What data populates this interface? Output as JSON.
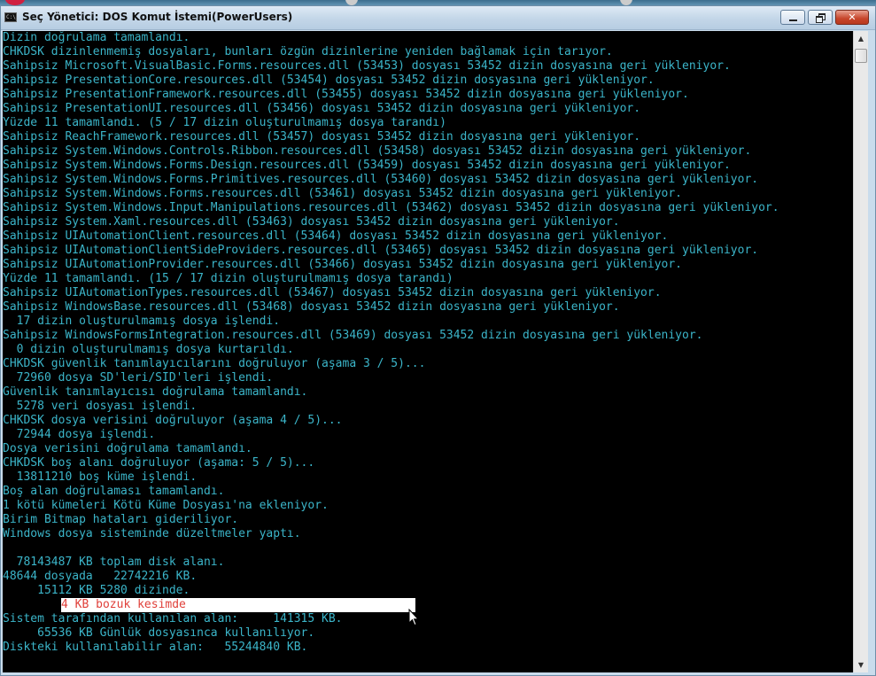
{
  "window": {
    "title": "Seç Yönetici: DOS Komut İstemi(PowerUsers)",
    "icon_label": "C:\\",
    "controls": {
      "minimize": "minimize",
      "maximize": "restore",
      "close": "x"
    }
  },
  "console": {
    "lines": [
      "Dizin doğrulama tamamlandı.",
      "CHKDSK dizinlenmemiş dosyaları, bunları özgün dizinlerine yeniden bağlamak için tarıyor.",
      "Sahipsiz Microsoft.VisualBasic.Forms.resources.dll (53453) dosyası 53452 dizin dosyasına geri yükleniyor.",
      "Sahipsiz PresentationCore.resources.dll (53454) dosyası 53452 dizin dosyasına geri yükleniyor.",
      "Sahipsiz PresentationFramework.resources.dll (53455) dosyası 53452 dizin dosyasına geri yükleniyor.",
      "Sahipsiz PresentationUI.resources.dll (53456) dosyası 53452 dizin dosyasına geri yükleniyor.",
      "Yüzde 11 tamamlandı. (5 / 17 dizin oluşturulmamış dosya tarandı)",
      "Sahipsiz ReachFramework.resources.dll (53457) dosyası 53452 dizin dosyasına geri yükleniyor.",
      "Sahipsiz System.Windows.Controls.Ribbon.resources.dll (53458) dosyası 53452 dizin dosyasına geri yükleniyor.",
      "Sahipsiz System.Windows.Forms.Design.resources.dll (53459) dosyası 53452 dizin dosyasına geri yükleniyor.",
      "Sahipsiz System.Windows.Forms.Primitives.resources.dll (53460) dosyası 53452 dizin dosyasına geri yükleniyor.",
      "Sahipsiz System.Windows.Forms.resources.dll (53461) dosyası 53452 dizin dosyasına geri yükleniyor.",
      "Sahipsiz System.Windows.Input.Manipulations.resources.dll (53462) dosyası 53452 dizin dosyasına geri yükleniyor.",
      "Sahipsiz System.Xaml.resources.dll (53463) dosyası 53452 dizin dosyasına geri yükleniyor.",
      "Sahipsiz UIAutomationClient.resources.dll (53464) dosyası 53452 dizin dosyasına geri yükleniyor.",
      "Sahipsiz UIAutomationClientSideProviders.resources.dll (53465) dosyası 53452 dizin dosyasına geri yükleniyor.",
      "Sahipsiz UIAutomationProvider.resources.dll (53466) dosyası 53452 dizin dosyasına geri yükleniyor.",
      "Yüzde 11 tamamlandı. (15 / 17 dizin oluşturulmamış dosya tarandı)",
      "Sahipsiz UIAutomationTypes.resources.dll (53467) dosyası 53452 dizin dosyasına geri yükleniyor.",
      "Sahipsiz WindowsBase.resources.dll (53468) dosyası 53452 dizin dosyasına geri yükleniyor.",
      "  17 dizin oluşturulmamış dosya işlendi.",
      "Sahipsiz WindowsFormsIntegration.resources.dll (53469) dosyası 53452 dizin dosyasına geri yükleniyor.",
      "  0 dizin oluşturulmamış dosya kurtarıldı.",
      "CHKDSK güvenlik tanımlayıcılarını doğruluyor (aşama 3 / 5)...",
      "  72960 dosya SD'leri/SID'leri işlendi.",
      "Güvenlik tanımlayıcısı doğrulama tamamlandı.",
      "  5278 veri dosyası işlendi.",
      "CHKDSK dosya verisini doğruluyor (aşama 4 / 5)...",
      "  72944 dosya işlendi.",
      "Dosya verisini doğrulama tamamlandı.",
      "CHKDSK boş alanı doğruluyor (aşama: 5 / 5)...",
      "  13811210 boş küme işlendi.",
      "Boş alan doğrulaması tamamlandı.",
      "1 kötü kümeleri Kötü Küme Dosyası'na ekleniyor.",
      "Birim Bitmap hataları gideriliyor.",
      "Windows dosya sisteminde düzeltmeler yaptı.",
      "",
      "  78143487 KB toplam disk alanı.",
      "48644 dosyada   22742216 KB.",
      "     15112 KB 5280 dizinde.",
      "4 KB bozuk kesimde",
      "Sistem tarafından kullanılan alan:     141315 KB.",
      "     65536 KB Günlük dosyasınca kullanılıyor.",
      "Diskteki kullanılabilir alan:   55244840 KB."
    ],
    "highlight_index": 40
  },
  "colors": {
    "text": "#3bb5c9",
    "highlight_text": "#e0403a",
    "highlight_bg": "#ffffff",
    "background": "#000000"
  }
}
